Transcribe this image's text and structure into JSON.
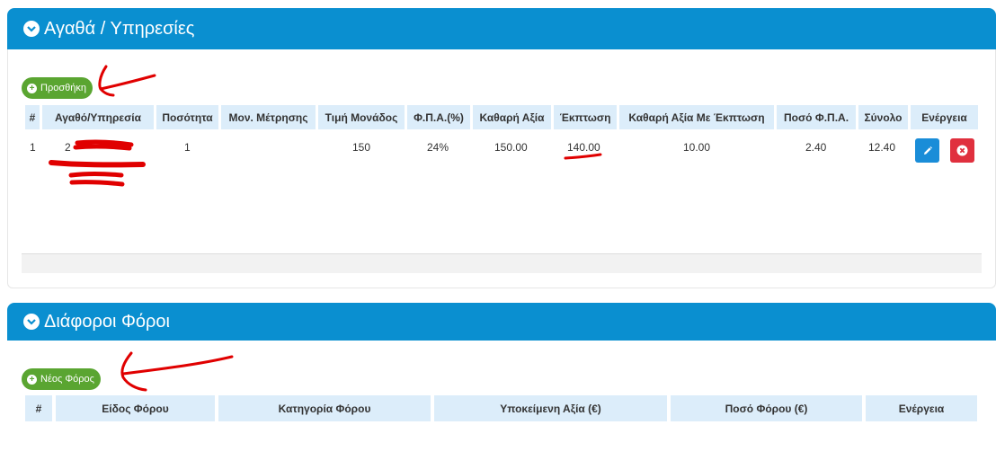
{
  "goods_panel": {
    "title": "Αγαθά / Υπηρεσίες",
    "add_button": "Προσθήκη",
    "columns": [
      "#",
      "Αγαθό/Υπηρεσία",
      "Ποσότητα",
      "Μον. Μέτρησης",
      "Τιμή Μονάδος",
      "Φ.Π.Α.(%)",
      "Καθαρή Αξία",
      "Έκπτωση",
      "Καθαρή Αξία Με Έκπτωση",
      "Ποσό Φ.Π.Α.",
      "Σύνολο",
      "Ενέργεια"
    ],
    "row": {
      "index": "1",
      "item": "2",
      "quantity": "1",
      "unit": "",
      "unit_price": "150",
      "vat_percent": "24%",
      "net_value": "150.00",
      "discount": "140.00",
      "net_after_discount": "10.00",
      "vat_amount": "2.40",
      "total": "12.40"
    },
    "icons": {
      "edit": "pencil-icon",
      "delete": "close-circle-icon"
    }
  },
  "taxes_panel": {
    "title": "Διάφοροι Φόροι",
    "add_button": "Νέος Φόρος",
    "columns": [
      "#",
      "Είδος Φόρου",
      "Κατηγορία Φόρου",
      "Υποκείμενη Αξία (€)",
      "Ποσό Φόρου (€)",
      "Ενέργεια"
    ]
  },
  "colors": {
    "header": "#0a8fd0",
    "header_cell": "#dcedfa",
    "add_button": "#5aa531",
    "edit_button": "#1a8dd8",
    "delete_button": "#e0303e",
    "annotation": "#e00000"
  }
}
